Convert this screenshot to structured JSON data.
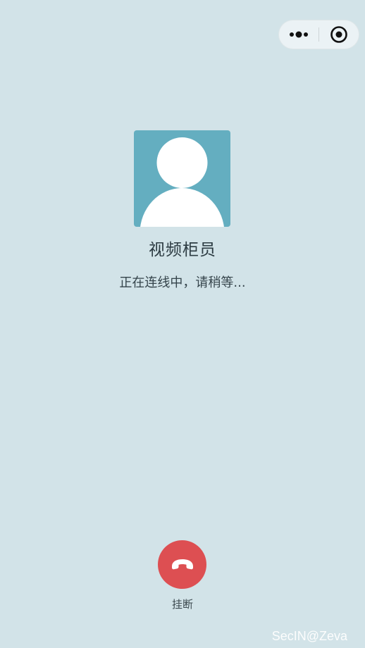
{
  "capsule": {
    "more_icon": "more-dots-icon",
    "close_icon": "target-close-icon"
  },
  "caller": {
    "avatar_icon": "user-avatar-icon",
    "name": "视频柜员",
    "status": "正在连线中，请稍等..."
  },
  "hangup": {
    "icon": "phone-hangup-icon",
    "label": "挂断"
  },
  "watermark": "SecIN@Zeva",
  "colors": {
    "background": "#d2e3e8",
    "avatar_bg": "#64aec0",
    "hangup_red": "#dd4f52"
  }
}
